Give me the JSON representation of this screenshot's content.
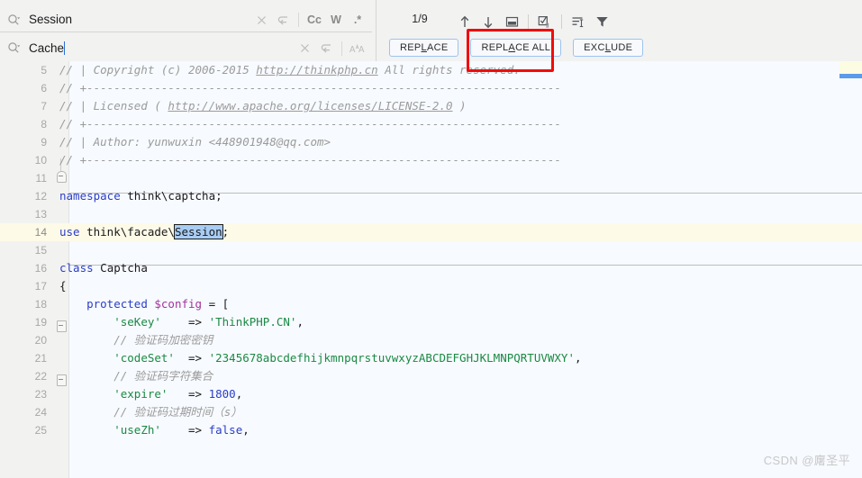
{
  "find_panel": {
    "search": {
      "icon": "search-dropdown-icon",
      "value": "Session",
      "placeholder": "Search",
      "clear_icon": "close-icon",
      "history_icon": "revert-arrow-icon",
      "toggles": [
        {
          "name": "match-case-toggle",
          "label": "Cc"
        },
        {
          "name": "words-toggle",
          "label": "W"
        },
        {
          "name": "regex-toggle",
          "label": ".*"
        }
      ]
    },
    "replace": {
      "icon": "search-dropdown-icon",
      "value": "Cache",
      "placeholder": "Replace",
      "clear_icon": "close-icon",
      "history_icon": "revert-arrow-icon",
      "toggles": [
        {
          "name": "preserve-case-toggle",
          "label": "A↑A"
        }
      ]
    },
    "counter": "1/9",
    "nav_icons": [
      {
        "name": "find-previous-icon",
        "glyph": "↑"
      },
      {
        "name": "find-next-icon",
        "glyph": "↓"
      },
      {
        "name": "open-in-new-window-icon",
        "glyph": "window"
      },
      {
        "name": "select-all-occurrences-icon",
        "glyph": "checkbox-cursor"
      },
      {
        "name": "find-in-selection-icon",
        "glyph": "text-lines"
      },
      {
        "name": "filter-icon",
        "glyph": "funnel"
      }
    ],
    "buttons": [
      {
        "name": "replace-button",
        "pre": "REP",
        "mnemonic": "L",
        "post": "ACE"
      },
      {
        "name": "replace-all-button",
        "pre": "REPL",
        "mnemonic": "A",
        "post": "CE ALL"
      },
      {
        "name": "exclude-button",
        "pre": "EXC",
        "mnemonic": "L",
        "post": "UDE"
      }
    ],
    "annotation": {
      "name": "red-highlight-box",
      "color": "#f00c0c"
    }
  },
  "editor": {
    "current_line": 14,
    "selection_text": "Session",
    "lines": [
      {
        "n": "5",
        "kind": "comment",
        "text": "// | Copyright (c) 2006-2015 ",
        "link": "http://thinkphp.cn",
        "tail": " All rights reserved."
      },
      {
        "n": "6",
        "kind": "comment",
        "text": "// +----------------------------------------------------------------------"
      },
      {
        "n": "7",
        "kind": "comment",
        "text": "// | Licensed ( ",
        "link": "http://www.apache.org/licenses/LICENSE-2.0",
        "tail": " )"
      },
      {
        "n": "8",
        "kind": "comment",
        "text": "// +----------------------------------------------------------------------"
      },
      {
        "n": "9",
        "kind": "comment",
        "text": "// | Author: yunwuxin <448901948@qq.com>"
      },
      {
        "n": "10",
        "kind": "comment",
        "text": "// +----------------------------------------------------------------------"
      },
      {
        "n": "11",
        "kind": "blank",
        "text": ""
      },
      {
        "n": "12",
        "kind": "code",
        "text": "namespace think\\captcha;"
      },
      {
        "n": "13",
        "kind": "blank",
        "text": ""
      },
      {
        "n": "14",
        "kind": "code",
        "text": "use think\\facade\\Session;"
      },
      {
        "n": "15",
        "kind": "blank",
        "text": ""
      },
      {
        "n": "16",
        "kind": "code",
        "text": "class Captcha"
      },
      {
        "n": "17",
        "kind": "code",
        "text": "{"
      },
      {
        "n": "18",
        "kind": "code",
        "text": "    protected $config = ["
      },
      {
        "n": "19",
        "kind": "code",
        "text": "        'seKey'    => 'ThinkPHP.CN',"
      },
      {
        "n": "20",
        "kind": "comment",
        "text": "        // 验证码加密密钥"
      },
      {
        "n": "21",
        "kind": "code",
        "text": "        'codeSet'  => '2345678abcdefhijkmnpqrstuvwxyzABCDEFGHJKLMNPQRTUVWXY',"
      },
      {
        "n": "22",
        "kind": "comment",
        "text": "        // 验证码字符集合"
      },
      {
        "n": "23",
        "kind": "code",
        "text": "        'expire'   => 1800,"
      },
      {
        "n": "24",
        "kind": "comment",
        "text": "        // 验证码过期时间（s）"
      },
      {
        "n": "25",
        "kind": "code",
        "text": "        'useZh'    => false,"
      }
    ]
  },
  "watermark": "CSDN @廜圣平",
  "colors": {
    "keyword": "#2a3ec7",
    "string": "#1a8a43",
    "comment": "#9b9b99",
    "variable": "#a4339b",
    "selection": "#a8cdf5",
    "current_line": "#fdfae8",
    "annotation": "#f00c0c",
    "button_border": "#9dc3f0"
  }
}
